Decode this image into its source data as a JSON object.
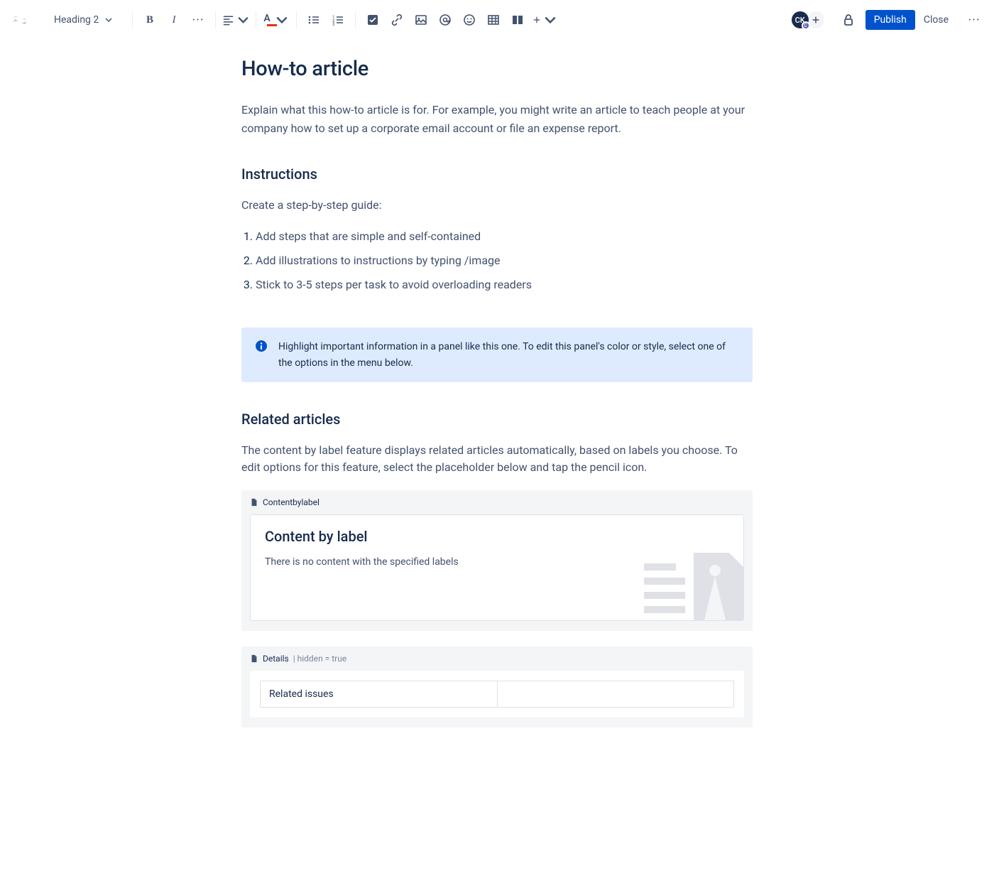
{
  "toolbar": {
    "text_style": "Heading 2",
    "publish_label": "Publish",
    "close_label": "Close"
  },
  "avatar": {
    "initials": "CK",
    "badge": "C"
  },
  "page": {
    "title": "How-to article",
    "intro": "Explain what this how-to article is for. For example, you might write an article to teach people at your company how to set up a corporate email account or file an expense report."
  },
  "instructions": {
    "heading": "Instructions",
    "lead": "Create a step-by-step guide:",
    "steps": [
      "Add steps that are simple and self-contained",
      "Add illustrations to instructions by typing /image",
      "Stick to 3-5 steps per task to avoid overloading readers"
    ]
  },
  "panel": {
    "text": "Highlight important information in a panel like this one. To edit this panel's color or style, select one of the options in the menu below."
  },
  "related": {
    "heading": "Related articles",
    "description": "The content by label feature displays related articles automatically, based on labels you choose. To edit options for this feature, select the placeholder below and tap the pencil icon."
  },
  "content_by_label": {
    "macro_name": "Contentbylabel",
    "title": "Content by label",
    "empty_message": "There is no content with the specified labels"
  },
  "details": {
    "macro_name": "Details",
    "macro_meta": " | hidden = true",
    "row_label": "Related issues",
    "row_value": ""
  }
}
